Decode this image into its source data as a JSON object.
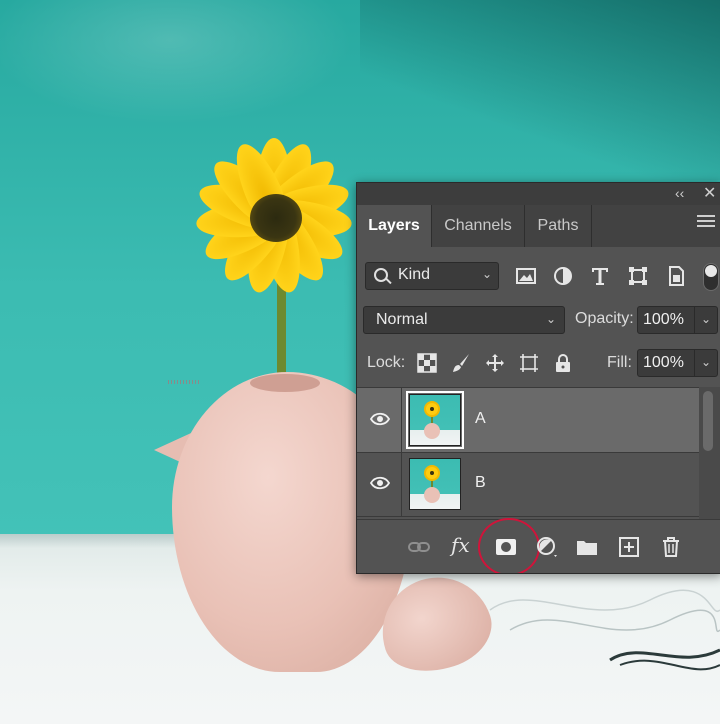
{
  "panel": {
    "tabs": [
      {
        "label": "Layers",
        "active": true
      },
      {
        "label": "Channels",
        "active": false
      },
      {
        "label": "Paths",
        "active": false
      }
    ],
    "collapse_glyph": "‹‹",
    "close_glyph": "✕",
    "filter": {
      "label": "Kind",
      "icon": "search-icon"
    },
    "filter_icons": [
      "image-filter-icon",
      "adjustment-filter-icon",
      "type-filter-icon",
      "shape-filter-icon",
      "smart-object-filter-icon"
    ],
    "blend_mode": "Normal",
    "opacity_label": "Opacity:",
    "opacity_value": "100%",
    "lock_label": "Lock:",
    "lock_icons": [
      "lock-transparent-pixels-icon",
      "lock-image-pixels-icon",
      "lock-position-icon",
      "lock-artboard-icon",
      "lock-all-icon"
    ],
    "fill_label": "Fill:",
    "fill_value": "100%",
    "layers": [
      {
        "name": "A",
        "visible": true,
        "selected": true
      },
      {
        "name": "B",
        "visible": true,
        "selected": false
      }
    ],
    "footer_icons": [
      "link-layers-icon",
      "fx-icon",
      "add-mask-icon",
      "adjustment-layer-icon",
      "new-group-icon",
      "new-layer-icon",
      "delete-icon"
    ],
    "fx_text": "fx",
    "highlight_color": "#d0143a"
  }
}
